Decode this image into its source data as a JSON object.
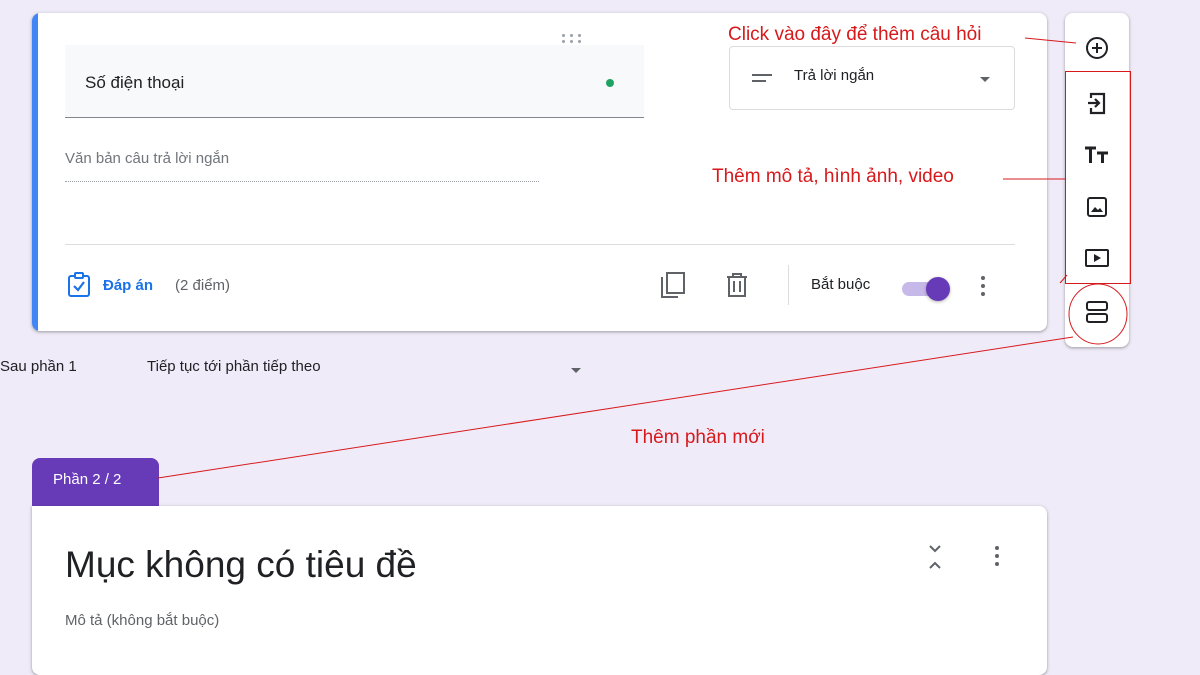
{
  "question": {
    "title": "Số điện thoại",
    "type_label": "Trả lời ngắn",
    "answer_placeholder": "Văn bản câu trả lời ngắn",
    "answer_key_label": "Đáp án",
    "points": "(2 điểm)",
    "required_label": "Bắt buộc",
    "required": true
  },
  "after_section": {
    "label": "Sau phần 1",
    "value": "Tiếp tục tới phần tiếp theo"
  },
  "section": {
    "tab_label": "Phần 2 / 2",
    "title": "Mục không có tiêu đề",
    "description": "Mô tả (không bắt buộc)"
  },
  "sidebar": {
    "buttons": [
      "add-question-icon",
      "import-questions-icon",
      "add-title-icon",
      "add-image-icon",
      "add-video-icon",
      "add-section-icon"
    ]
  },
  "annotations": {
    "add_question": "Click vào đây để thêm câu hỏi",
    "add_media": "Thêm mô tả, hình ảnh, video",
    "add_section": "Thêm phần mới"
  },
  "colors": {
    "accent_blue": "#4285f4",
    "theme_purple": "#673ab7",
    "background": "#f0ebf8",
    "annotation_red": "#d7191c",
    "link_blue": "#1a73e8"
  }
}
